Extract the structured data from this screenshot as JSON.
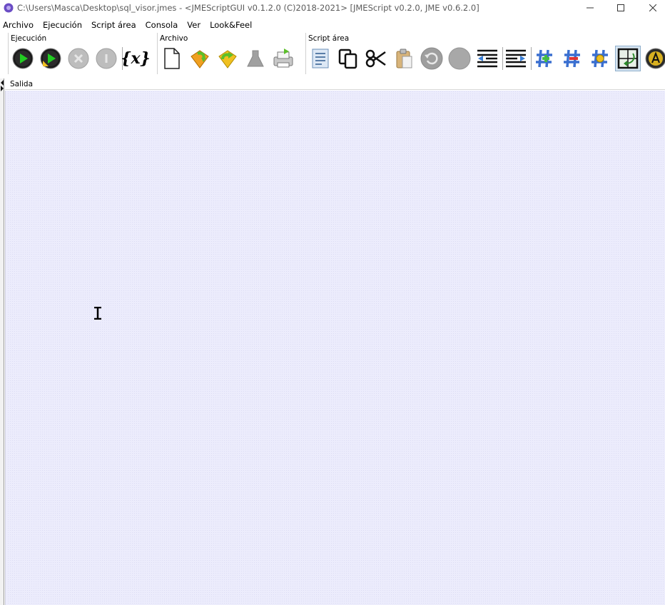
{
  "window": {
    "title": "C:\\Users\\Masca\\Desktop\\sql_visor.jmes  -  <JMEScriptGUI v0.1.2.0  (C)2018-2021>   [JMEScript v0.2.0, JME v0.6.2.0]"
  },
  "menu": {
    "items": [
      "Archivo",
      "Ejecución",
      "Script área",
      "Consola",
      "Ver",
      "Look&Feel"
    ]
  },
  "toolbar": {
    "groups": {
      "ejecucion": "Ejecución",
      "archivo": "Archivo",
      "script_area": "Script área"
    },
    "variables_glyph": "{x}"
  },
  "output": {
    "title": "Salida"
  },
  "colors": {
    "output_bg": "#ececfc",
    "play_green": "#22cc22",
    "folder_orange": "#f0a020",
    "arrow_green": "#5cbf2a",
    "hash_green": "#44bb44",
    "hash_red": "#dd3333"
  }
}
